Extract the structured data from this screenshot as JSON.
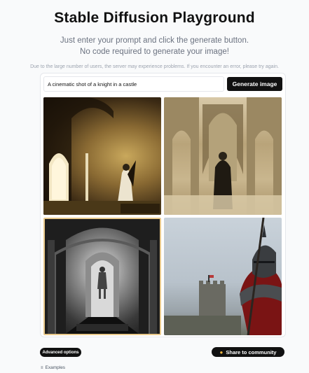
{
  "header": {
    "title": "Stable Diffusion Playground",
    "subtitle_line1": "Just enter your prompt and click the generate button.",
    "subtitle_line2": "No code required to generate your image!",
    "notice": "Due to the large number of users, the server may experience problems. If you encounter an error, please try again."
  },
  "prompt": {
    "value": "A cinematic shot of a knight in a castle",
    "button_label": "Generate image"
  },
  "gallery": {
    "image_count": 4
  },
  "footer": {
    "advanced_label": "Advanced options",
    "share_label": "Share to community",
    "share_icon": "community-icon",
    "examples_label": "Examples",
    "examples_icon": "list-icon"
  },
  "colors": {
    "accent": "#111111",
    "background": "#f9fafb",
    "share_icon_color": "#f4b740"
  }
}
